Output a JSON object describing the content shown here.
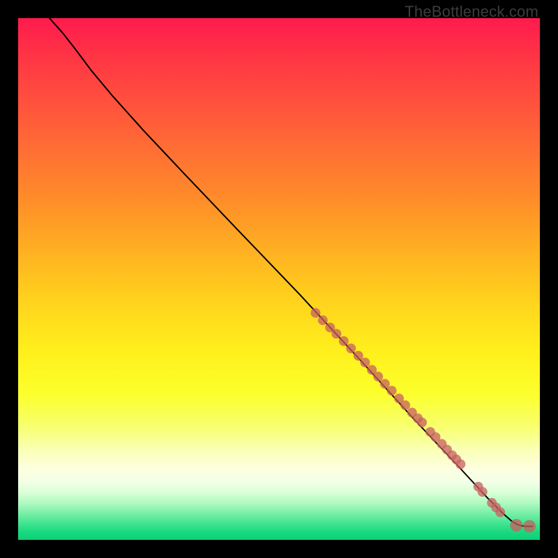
{
  "meta": {
    "watermark": "TheBottleneck.com"
  },
  "chart_data": {
    "type": "line",
    "title": "",
    "xlabel": "",
    "ylabel": "",
    "xlim": [
      0,
      100
    ],
    "ylim": [
      0,
      100
    ],
    "grid": false,
    "legend": false,
    "series": [
      {
        "name": "curve",
        "kind": "line",
        "path_xy": [
          [
            6.0,
            100.0
          ],
          [
            8.5,
            97.2
          ],
          [
            11.0,
            94.0
          ],
          [
            14.0,
            90.0
          ],
          [
            18.0,
            85.2
          ],
          [
            24.0,
            78.5
          ],
          [
            32.0,
            70.0
          ],
          [
            42.0,
            59.5
          ],
          [
            54.0,
            47.0
          ],
          [
            66.0,
            34.0
          ],
          [
            76.0,
            23.0
          ],
          [
            84.0,
            14.5
          ],
          [
            90.0,
            8.0
          ],
          [
            93.0,
            5.0
          ],
          [
            94.6,
            3.6
          ],
          [
            95.6,
            3.0
          ],
          [
            96.4,
            2.7
          ],
          [
            97.4,
            2.6
          ],
          [
            98.6,
            2.6
          ]
        ]
      },
      {
        "name": "big-markers",
        "kind": "scatter",
        "radius": 9,
        "xy": [
          [
            95.5,
            2.8
          ],
          [
            98.0,
            2.6
          ]
        ]
      },
      {
        "name": "dense-markers",
        "kind": "scatter",
        "radius": 7,
        "xy": [
          [
            57.0,
            43.5
          ],
          [
            58.4,
            42.1
          ],
          [
            59.8,
            40.7
          ],
          [
            61.0,
            39.5
          ],
          [
            62.4,
            38.1
          ],
          [
            63.8,
            36.7
          ],
          [
            65.2,
            35.3
          ],
          [
            66.5,
            34.0
          ],
          [
            67.8,
            32.6
          ],
          [
            69.0,
            31.3
          ],
          [
            70.3,
            29.9
          ],
          [
            71.6,
            28.6
          ],
          [
            73.0,
            27.1
          ],
          [
            74.2,
            25.8
          ],
          [
            75.5,
            24.4
          ],
          [
            76.6,
            23.3
          ],
          [
            77.4,
            22.5
          ],
          [
            79.0,
            20.7
          ],
          [
            80.0,
            19.7
          ],
          [
            81.2,
            18.4
          ],
          [
            82.2,
            17.3
          ],
          [
            83.2,
            16.2
          ],
          [
            84.0,
            15.4
          ],
          [
            84.8,
            14.5
          ],
          [
            88.2,
            10.2
          ],
          [
            89.0,
            9.2
          ],
          [
            90.8,
            7.1
          ],
          [
            91.6,
            6.2
          ],
          [
            92.4,
            5.3
          ]
        ]
      }
    ]
  }
}
